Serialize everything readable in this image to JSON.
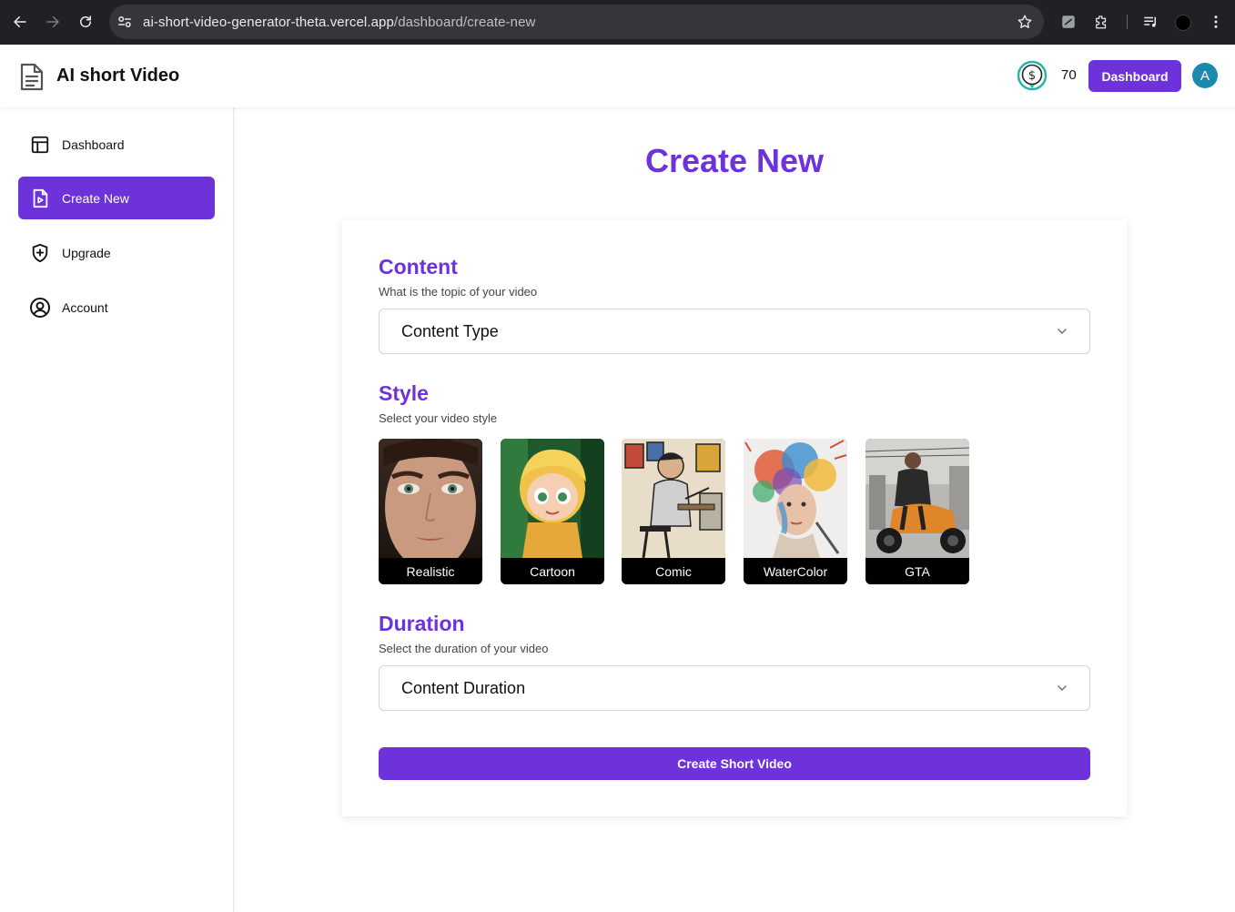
{
  "browser": {
    "url_host": "ai-short-video-generator-theta.vercel.app",
    "url_path": "/dashboard/create-new"
  },
  "header": {
    "app_title": "AI short Video",
    "credits": "70",
    "dashboard_button": "Dashboard",
    "avatar_initial": "A"
  },
  "sidebar": {
    "items": [
      {
        "label": "Dashboard",
        "icon": "layout-icon",
        "active": false
      },
      {
        "label": "Create New",
        "icon": "file-video-icon",
        "active": true
      },
      {
        "label": "Upgrade",
        "icon": "shield-plus-icon",
        "active": false
      },
      {
        "label": "Account",
        "icon": "user-circle-icon",
        "active": false
      }
    ]
  },
  "main": {
    "page_title": "Create New",
    "content": {
      "title": "Content",
      "subtitle": "What is the topic of your video",
      "select_value": "Content Type"
    },
    "style": {
      "title": "Style",
      "subtitle": "Select your video style",
      "options": [
        "Realistic",
        "Cartoon",
        "Comic",
        "WaterColor",
        "GTA"
      ]
    },
    "duration": {
      "title": "Duration",
      "subtitle": "Select the duration of your video",
      "select_value": "Content Duration"
    },
    "create_button": "Create Short Video"
  },
  "colors": {
    "accent": "#6d32d9",
    "avatar": "#1a8bad"
  }
}
